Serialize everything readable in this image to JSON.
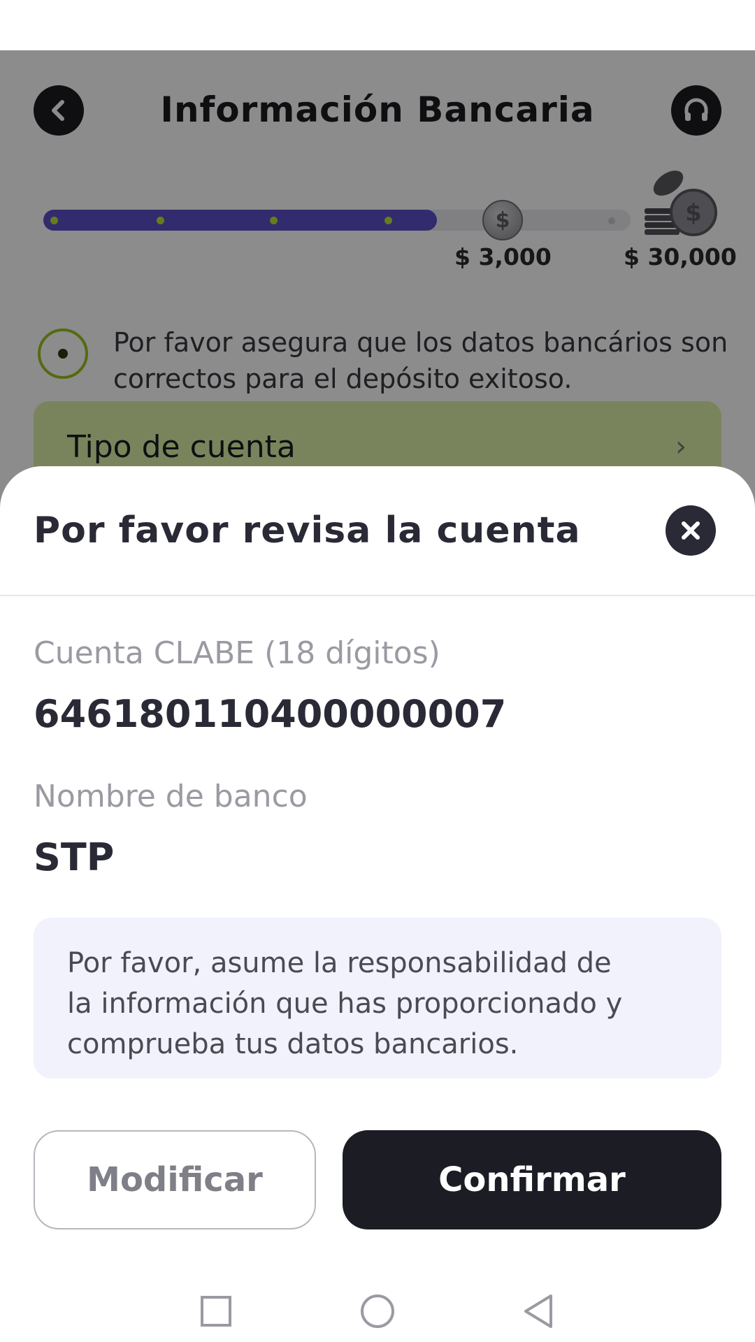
{
  "background": {
    "header": {
      "title": "Información Bancaria"
    },
    "progress": {
      "fill_fraction": 0.67,
      "current_milestone": "$ 3,000",
      "final_milestone": "$ 30,000"
    },
    "notice": "Por favor asegura que los datos bancários son correctos para el depósito exitoso.",
    "account_type_label": "Tipo de cuenta"
  },
  "sheet": {
    "title": "Por favor revisa la cuenta",
    "fields": [
      {
        "label": "Cuenta CLABE (18 dígitos)",
        "value": "646180110400000007"
      },
      {
        "label": "Nombre de banco",
        "value": "STP"
      }
    ],
    "info": "Por favor, asume la responsabilidad de la información que has proporcionado y comprueba tus datos bancarios.",
    "buttons": {
      "modify": "Modificar",
      "confirm": "Confirmar"
    }
  },
  "colors": {
    "accent": "#5b4fc7",
    "lime": "#b9e33a",
    "dark": "#1c1c24"
  },
  "icons": [
    "back-arrow-icon",
    "support-headset-icon",
    "coin-icon",
    "target-icon",
    "chevron-right-icon",
    "close-icon",
    "nav-recents-icon",
    "nav-home-icon",
    "nav-back-icon"
  ]
}
